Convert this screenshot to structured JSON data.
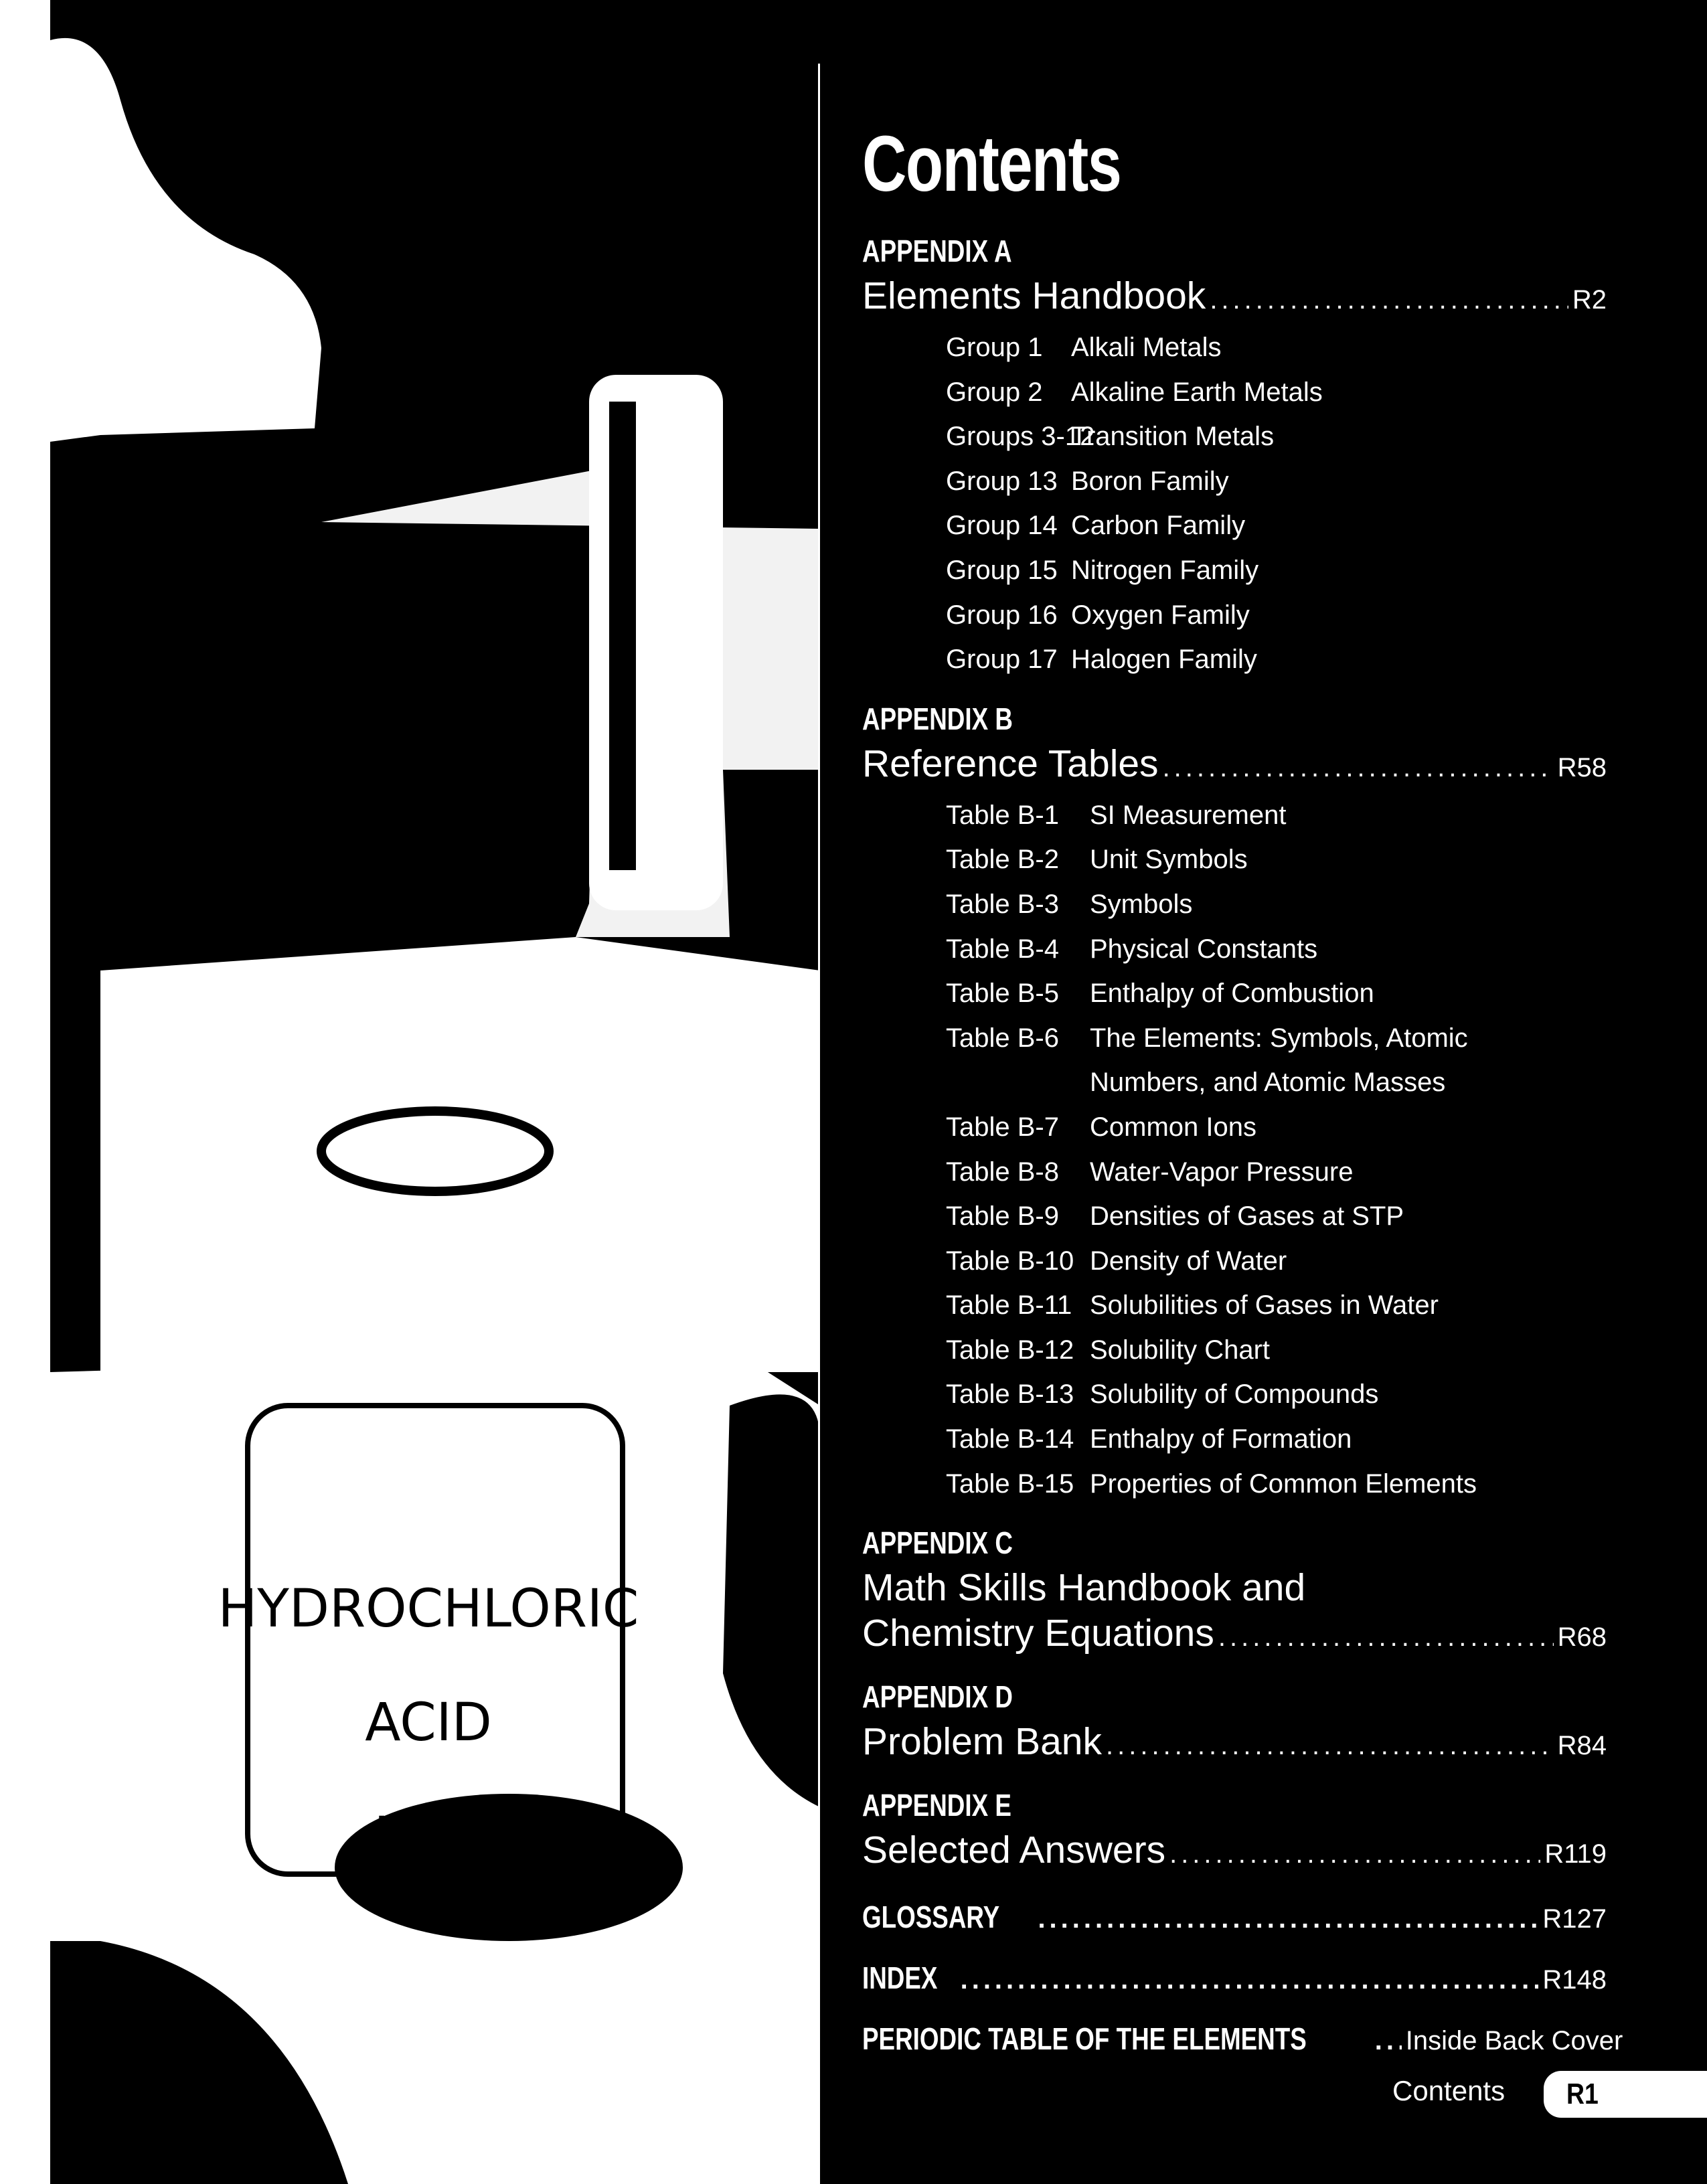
{
  "page_title": "Contents",
  "photo_label": [
    "HYDROCHLORIC",
    "ACID",
    "HC1"
  ],
  "appendices": [
    {
      "label": "APPENDIX A",
      "title": "Elements Handbook",
      "page": "R2",
      "kind": "ga",
      "items": [
        {
          "key": "Group 1",
          "text": "Alkali Metals"
        },
        {
          "key": "Group 2",
          "text": "Alkaline Earth Metals"
        },
        {
          "key": "Groups 3-12",
          "text": "Transition Metals"
        },
        {
          "key": "Group 13",
          "text": "Boron Family"
        },
        {
          "key": "Group 14",
          "text": "Carbon Family"
        },
        {
          "key": "Group 15",
          "text": "Nitrogen Family"
        },
        {
          "key": "Group 16",
          "text": "Oxygen Family"
        },
        {
          "key": "Group 17",
          "text": "Halogen Family"
        }
      ]
    },
    {
      "label": "APPENDIX B",
      "title": "Reference Tables",
      "page": "R58",
      "kind": "tb",
      "items": [
        {
          "key": "Table B-1",
          "text": "SI Measurement"
        },
        {
          "key": "Table B-2",
          "text": "Unit Symbols"
        },
        {
          "key": "Table B-3",
          "text": "Symbols"
        },
        {
          "key": "Table B-4",
          "text": "Physical Constants"
        },
        {
          "key": "Table B-5",
          "text": "Enthalpy of Combustion"
        },
        {
          "key": "Table B-6",
          "text": "The Elements: Symbols, Atomic"
        },
        {
          "key": "",
          "text": "Numbers, and Atomic Masses"
        },
        {
          "key": "Table B-7",
          "text": "Common Ions"
        },
        {
          "key": "Table B-8",
          "text": "Water-Vapor Pressure"
        },
        {
          "key": "Table B-9",
          "text": "Densities of Gases at STP"
        },
        {
          "key": "Table B-10",
          "text": "Density of Water"
        },
        {
          "key": "Table B-11",
          "text": "Solubilities of Gases in Water"
        },
        {
          "key": "Table B-12",
          "text": "Solubility Chart"
        },
        {
          "key": "Table B-13",
          "text": "Solubility of Compounds"
        },
        {
          "key": "Table B-14",
          "text": "Enthalpy of Formation"
        },
        {
          "key": "Table B-15",
          "text": "Properties of Common Elements"
        }
      ]
    },
    {
      "label": "APPENDIX C",
      "title_line1": "Math Skills Handbook and",
      "title": "Chemistry Equations",
      "page": "R68",
      "items": []
    },
    {
      "label": "APPENDIX D",
      "title": "Problem Bank",
      "page": "R84",
      "items": []
    },
    {
      "label": "APPENDIX E",
      "title": "Selected Answers",
      "page": "R119",
      "items": []
    }
  ],
  "extras": [
    {
      "label": "GLOSSARY",
      "page": "R127"
    },
    {
      "label": "INDEX",
      "page": "R148"
    },
    {
      "label": "PERIODIC TABLE OF THE ELEMENTS",
      "page": "Inside Back Cover"
    }
  ],
  "footer": {
    "section": "Contents",
    "page": "R1"
  }
}
